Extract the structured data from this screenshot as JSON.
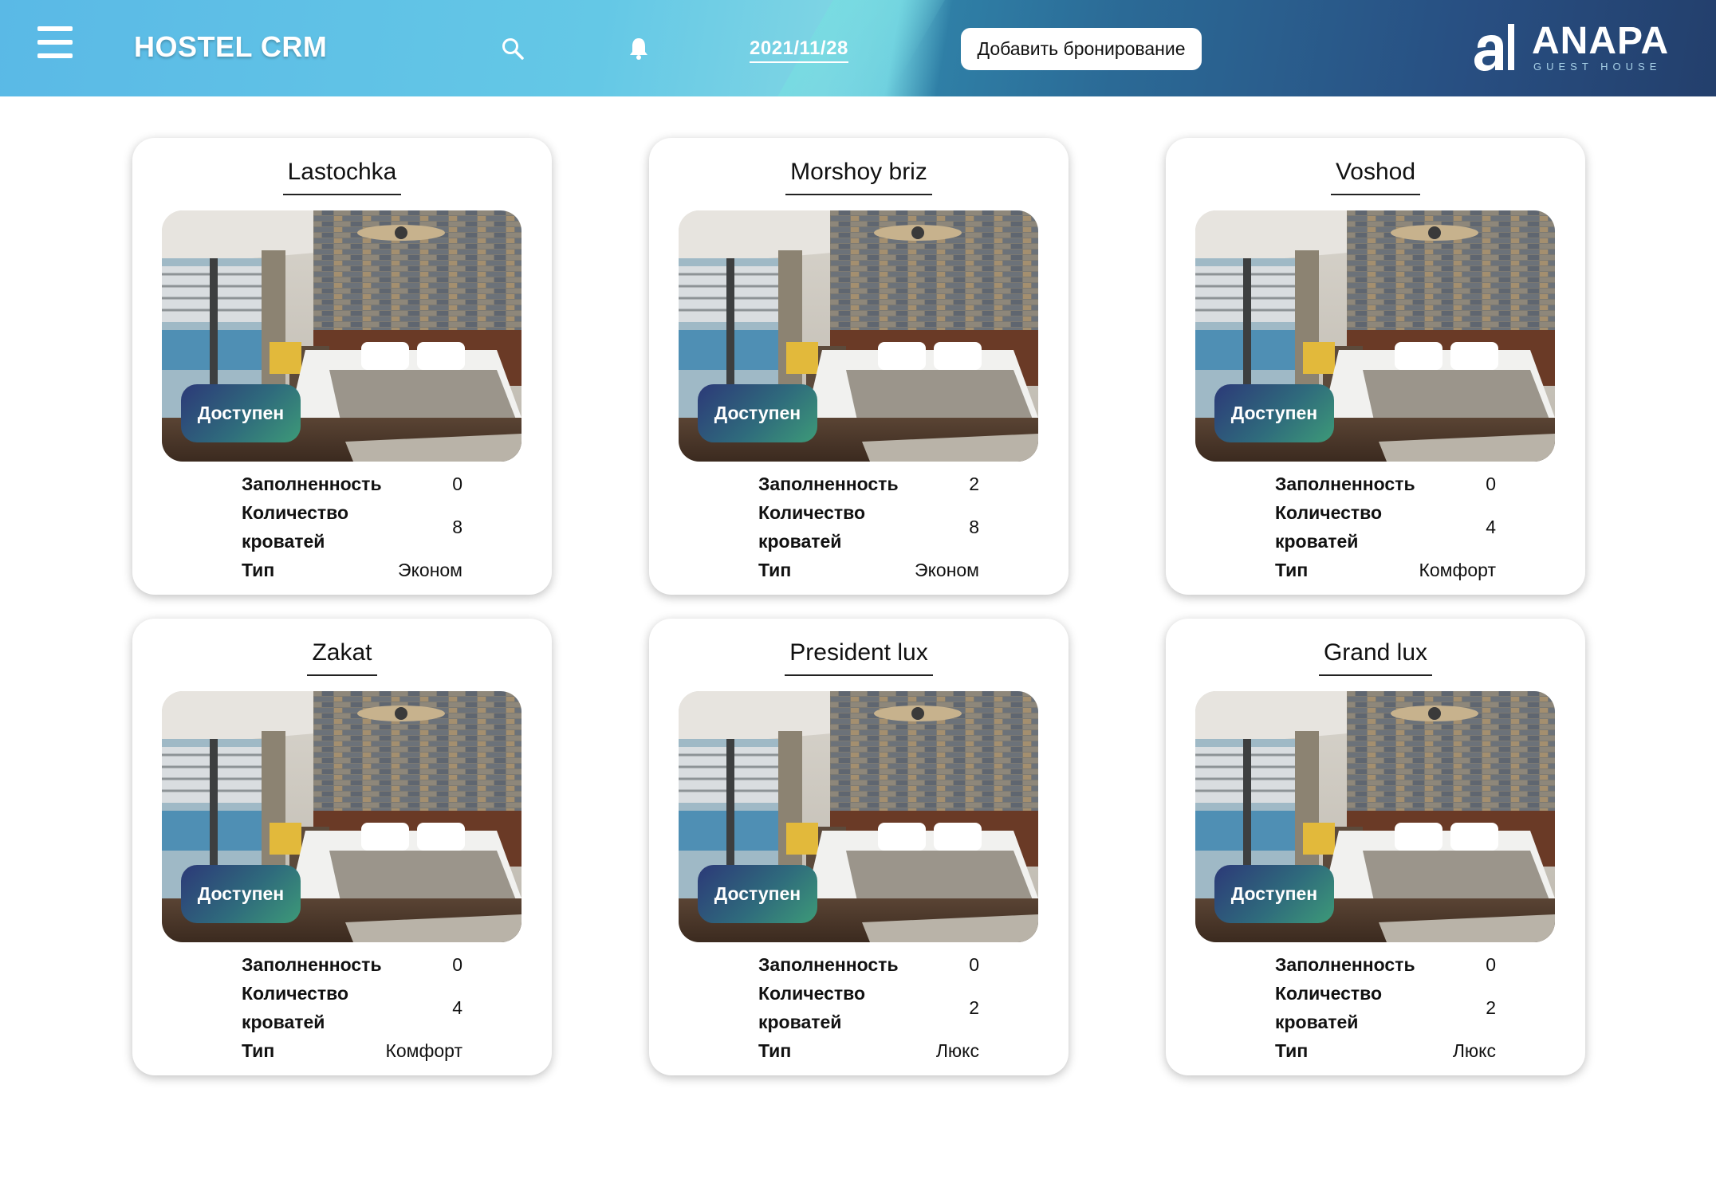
{
  "header": {
    "app_title": "HOSTEL CRM",
    "date": "2021/11/28",
    "add_button": "Добавить бронирование",
    "logo_text": "ANAPA",
    "logo_sub": "GUEST HOUSE",
    "icons": [
      "menu-icon",
      "search-icon",
      "bell-icon"
    ]
  },
  "labels": {
    "occupancy": "Заполненность",
    "beds_line1": "Количество",
    "beds_line2": "кроватей",
    "type": "Тип"
  },
  "colors": {
    "badge_start": "#2c3978",
    "badge_end": "#3d9a78"
  },
  "rooms": [
    {
      "name": "Lastochka",
      "status": "Доступен",
      "occupancy": "0",
      "beds": "8",
      "type": "Эконом"
    },
    {
      "name": "Morshoy briz",
      "status": "Доступен",
      "occupancy": "2",
      "beds": "8",
      "type": "Эконом"
    },
    {
      "name": "Voshod",
      "status": "Доступен",
      "occupancy": "0",
      "beds": "4",
      "type": "Комфорт"
    },
    {
      "name": "Zakat",
      "status": "Доступен",
      "occupancy": "0",
      "beds": "4",
      "type": "Комфорт"
    },
    {
      "name": "President lux",
      "status": "Доступен",
      "occupancy": "0",
      "beds": "2",
      "type": "Люкс"
    },
    {
      "name": "Grand lux",
      "status": "Доступен",
      "occupancy": "0",
      "beds": "2",
      "type": "Люкс"
    }
  ]
}
